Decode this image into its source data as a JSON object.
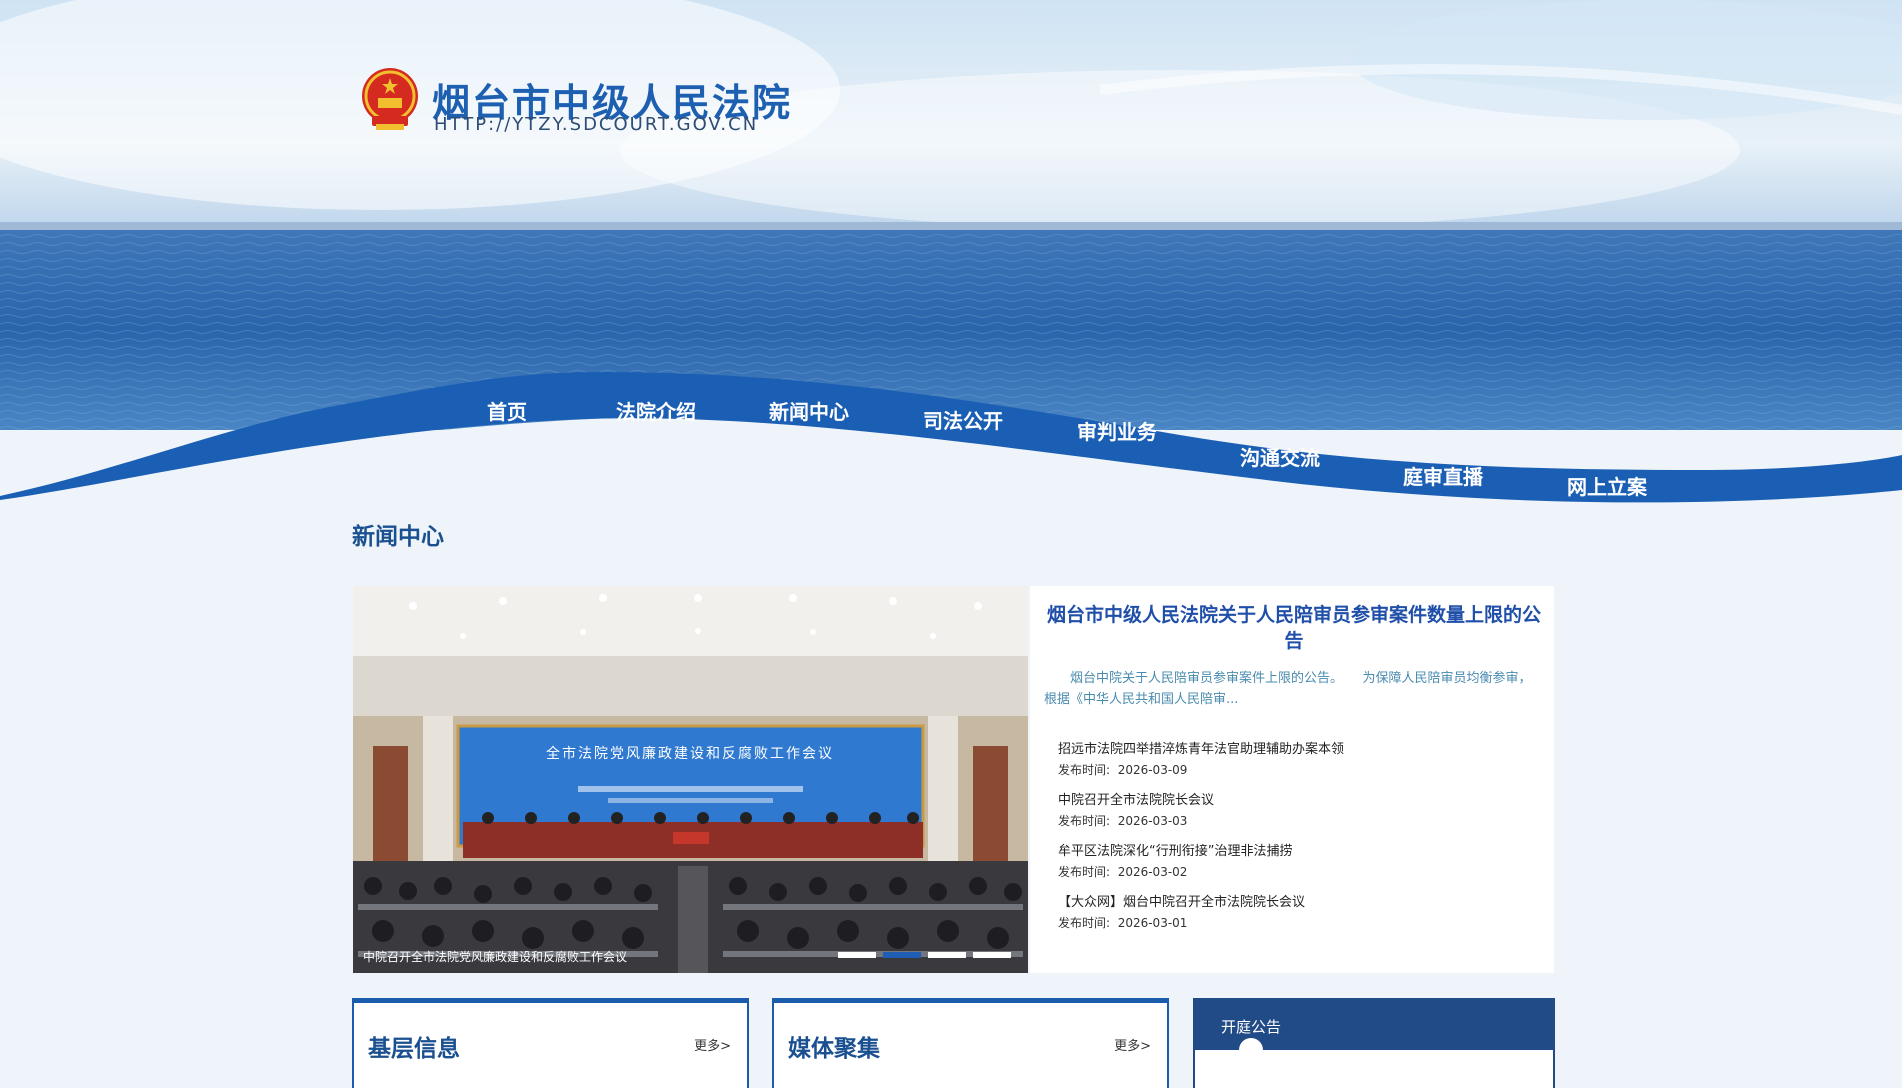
{
  "site": {
    "title": "烟台市中级人民法院",
    "url": "HTTP://YTZY.SDCOURT.GOV.CN"
  },
  "nav": [
    {
      "label": "首页"
    },
    {
      "label": "法院介绍"
    },
    {
      "label": "新闻中心"
    },
    {
      "label": "司法公开"
    },
    {
      "label": "审判业务"
    },
    {
      "label": "沟通交流"
    },
    {
      "label": "庭审直播"
    },
    {
      "label": "网上立案"
    }
  ],
  "section_title": "新闻中心",
  "carousel": {
    "screen_title": "全市法院党风廉政建设和反腐败工作会议",
    "caption": "中院召开全市法院党风廉政建设和反腐败工作会议",
    "slide_count": 4,
    "active_slide": 2
  },
  "headline": {
    "title": "烟台市中级人民法院关于人民陪审员参审案件数量上限的公告",
    "summary": "烟台中院关于人民陪审员参审案件上限的公告。　　为保障人民陪审员均衡参审，根据《中华人民共和国人民陪审..."
  },
  "news": [
    {
      "title": "招远市法院四举措淬炼青年法官助理辅助办案本领",
      "date_label": "发布时间:",
      "date": "2026-03-09"
    },
    {
      "title": "中院召开全市法院院长会议",
      "date_label": "发布时间:",
      "date": "2026-03-03"
    },
    {
      "title": "牟平区法院深化“行刑衔接”治理非法捕捞",
      "date_label": "发布时间:",
      "date": "2026-03-02"
    },
    {
      "title": "【大众网】烟台中院召开全市法院院长会议",
      "date_label": "发布时间:",
      "date": "2026-03-01"
    }
  ],
  "boxes": [
    {
      "title": "基层信息",
      "more": "更多>"
    },
    {
      "title": "媒体聚集",
      "more": "更多>"
    }
  ],
  "court_notice": {
    "title": "开庭公告"
  },
  "colors": {
    "primary": "#1a5cab",
    "nav_wave": "#1b5fb5",
    "dark_header": "#214b86",
    "page_bg": "#eef4f9"
  }
}
